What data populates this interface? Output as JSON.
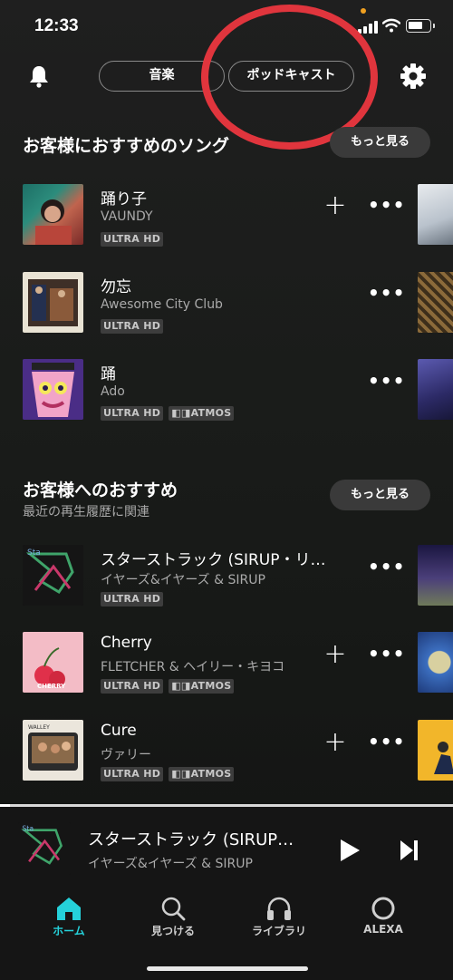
{
  "status": {
    "time": "12:33"
  },
  "header": {
    "tabs": [
      {
        "label": "音楽"
      },
      {
        "label": "ポッドキャスト"
      }
    ]
  },
  "section1": {
    "title": "お客様におすすめのソング",
    "more_label": "もっと見る",
    "tracks": [
      {
        "title": "踊り子",
        "artist": "VAUNDY",
        "badges": [
          "ULTRA HD"
        ],
        "add": true
      },
      {
        "title": "勿忘",
        "artist": "Awesome City Club",
        "badges": [
          "ULTRA HD"
        ],
        "add": false
      },
      {
        "title": "踊",
        "artist": "Ado",
        "badges": [
          "ULTRA HD",
          "ATMOS"
        ],
        "add": false
      }
    ]
  },
  "section2": {
    "title": "お客様へのおすすめ",
    "subtitle": "最近の再生履歴に関連",
    "more_label": "もっと見る",
    "tracks": [
      {
        "title": "スターストラック (SIRUP・リ…",
        "artist": "イヤーズ&イヤーズ & SIRUP",
        "badges": [
          "ULTRA HD"
        ],
        "add": false
      },
      {
        "title": "Cherry",
        "artist": "FLETCHER & ヘイリー・キヨコ",
        "badges": [
          "ULTRA HD",
          "ATMOS"
        ],
        "add": true
      },
      {
        "title": "Cure",
        "artist": "ヴァリー",
        "badges": [
          "ULTRA HD",
          "ATMOS"
        ],
        "add": true
      }
    ]
  },
  "now_playing": {
    "title": "スターストラック (SIRUP…",
    "artist": "イヤーズ&イヤーズ & SIRUP"
  },
  "nav": {
    "items": [
      {
        "label": "ホーム",
        "icon": "home-icon",
        "active": true
      },
      {
        "label": "見つける",
        "icon": "search-icon",
        "active": false
      },
      {
        "label": "ライブラリ",
        "icon": "headphones-icon",
        "active": false
      },
      {
        "label": "ALEXA",
        "icon": "alexa-icon",
        "active": false
      }
    ]
  },
  "colors": {
    "accent": "#25d1da",
    "annotation": "#e0353d"
  }
}
